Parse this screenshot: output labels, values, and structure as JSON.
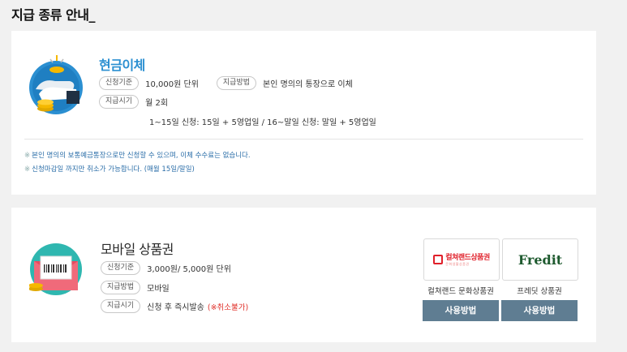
{
  "page": {
    "heading": "지급 종류 안내_"
  },
  "cash": {
    "title": "현금이체",
    "rows": [
      {
        "tag": "신청기준",
        "value": "10,000원 단위",
        "tag2": "지급방법",
        "value2": "본인 명의의 통장으로 이체"
      },
      {
        "tag": "지급시기",
        "value": "월 2회"
      }
    ],
    "schedule": "1~15일 신청: 15일 + 5영업일 / 16~말일 신청: 말일 + 5영업일",
    "notes": [
      "본인 명의의 보통예금통장으로만 신청할 수 있으며, 이체 수수료는 없습니다.",
      "신청마감일 까지만 취소가 가능합니다. (매월 15일/말일)"
    ],
    "note_mark": "※"
  },
  "voucher": {
    "title": "모바일 상품권",
    "rows": [
      {
        "tag": "신청기준",
        "value": "3,000원/ 5,000원 단위"
      },
      {
        "tag": "지급방법",
        "value": "모바일"
      },
      {
        "tag": "지급시기",
        "value": "신청 후 즉시발송",
        "warn": "(※취소불가)"
      }
    ],
    "brands": [
      {
        "logo_main": "컬쳐랜드상품권",
        "logo_sub": "문화생활상품권",
        "label": "컬쳐랜드 문화상품권",
        "button": "사용방법"
      },
      {
        "logo_main": "Fredit",
        "label": "프레딧 상품권",
        "button": "사용방법"
      }
    ]
  },
  "colors": {
    "accent_blue": "#2b8fd1",
    "button": "#5f7d92",
    "warn": "#e0302a"
  },
  "icons": {
    "cash": "hand-coins-icon",
    "voucher": "mobile-gift-card-icon"
  }
}
